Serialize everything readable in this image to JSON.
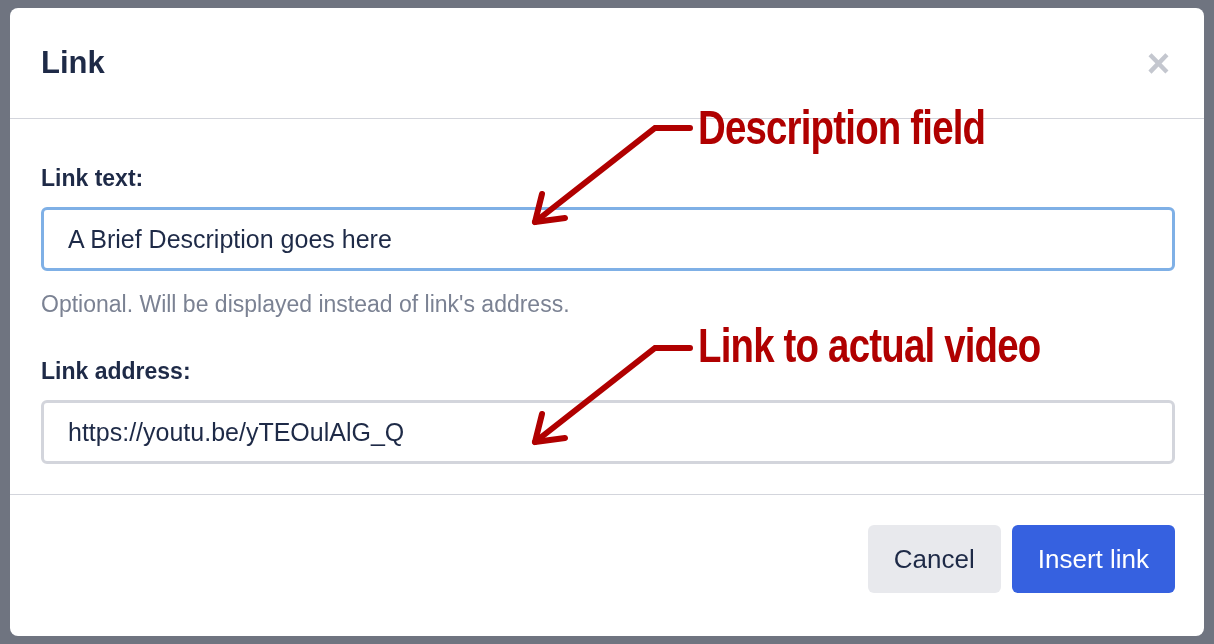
{
  "dialog": {
    "title": "Link",
    "close": "×",
    "fields": [
      {
        "label": "Link text:",
        "value": "A Brief Description goes here",
        "focused": true,
        "help": "Optional. Will be displayed instead of link's address."
      },
      {
        "label": "Link address:",
        "value": "https://youtu.be/yTEOulAlG_Q",
        "focused": false
      }
    ],
    "buttons": [
      {
        "label": "Cancel",
        "kind": "secondary"
      },
      {
        "label": "Insert link",
        "kind": "primary"
      }
    ]
  },
  "annotations": [
    "Description field",
    "Link to actual video"
  ]
}
